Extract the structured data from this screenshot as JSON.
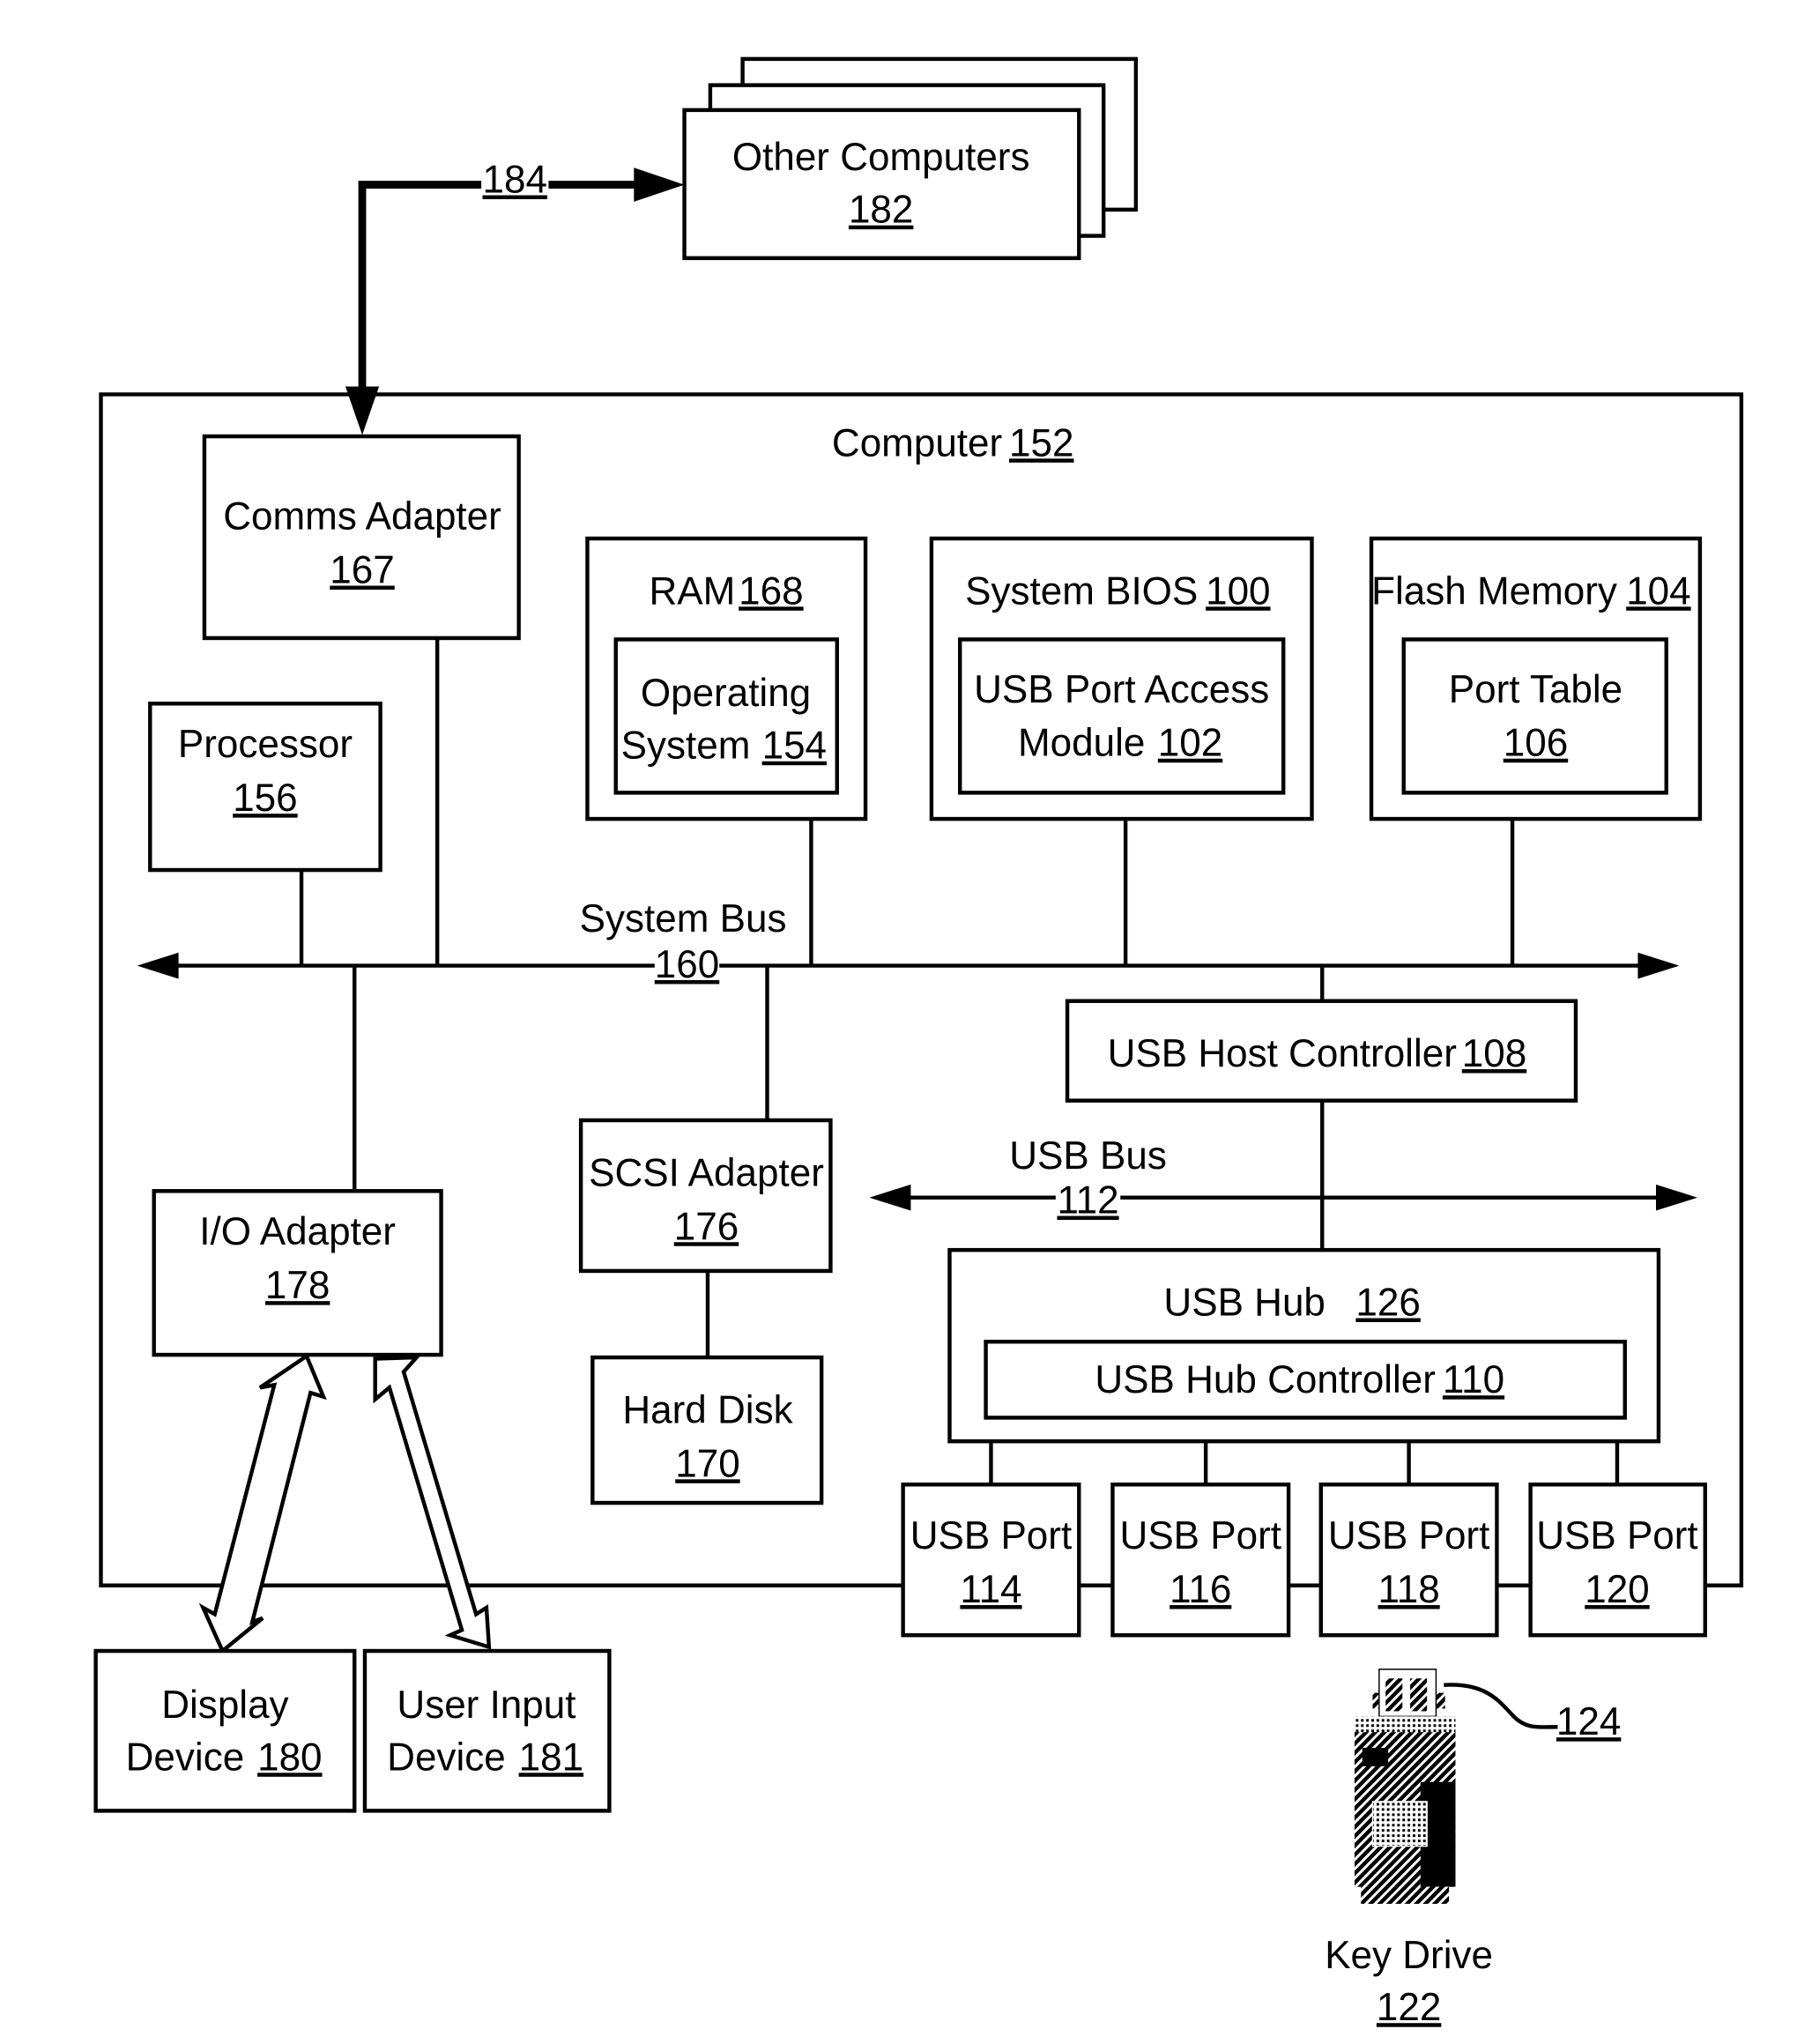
{
  "other_computers": {
    "label": "Other Computers",
    "ref": "182"
  },
  "network_link": {
    "ref": "184"
  },
  "computer": {
    "label": "Computer",
    "ref": "152"
  },
  "comms_adapter": {
    "label": "Comms Adapter",
    "ref": "167"
  },
  "processor": {
    "label": "Processor",
    "ref": "156"
  },
  "ram": {
    "label": "RAM",
    "ref": "168"
  },
  "operating_system": {
    "line1": "Operating",
    "line2": "System",
    "ref": "154"
  },
  "system_bios": {
    "label": "System BIOS",
    "ref": "100"
  },
  "usb_port_access_module": {
    "line1": "USB Port Access",
    "line2": "Module",
    "ref": "102"
  },
  "flash_memory": {
    "label": "Flash Memory",
    "ref": "104"
  },
  "port_table": {
    "label": "Port Table",
    "ref": "106"
  },
  "system_bus": {
    "label": "System Bus",
    "ref": "160"
  },
  "usb_host_controller": {
    "label": "USB Host Controller",
    "ref": "108"
  },
  "scsi_adapter": {
    "label": "SCSI Adapter",
    "ref": "176"
  },
  "hard_disk": {
    "label": "Hard Disk",
    "ref": "170"
  },
  "usb_bus": {
    "label": "USB Bus",
    "ref": "112"
  },
  "io_adapter": {
    "label": "I/O Adapter",
    "ref": "178"
  },
  "usb_hub": {
    "label": "USB Hub",
    "ref": "126"
  },
  "usb_hub_controller": {
    "label": "USB Hub Controller",
    "ref": "110"
  },
  "usb_ports": [
    {
      "label": "USB Port",
      "ref": "114"
    },
    {
      "label": "USB Port",
      "ref": "116"
    },
    {
      "label": "USB Port",
      "ref": "118"
    },
    {
      "label": "USB Port",
      "ref": "120"
    }
  ],
  "display_device": {
    "line1": "Display",
    "line2": "Device",
    "ref": "180"
  },
  "user_input_device": {
    "line1": "User Input",
    "line2": "Device",
    "ref": "181"
  },
  "key_drive": {
    "label": "Key Drive",
    "ref": "122",
    "connector_ref": "124"
  }
}
